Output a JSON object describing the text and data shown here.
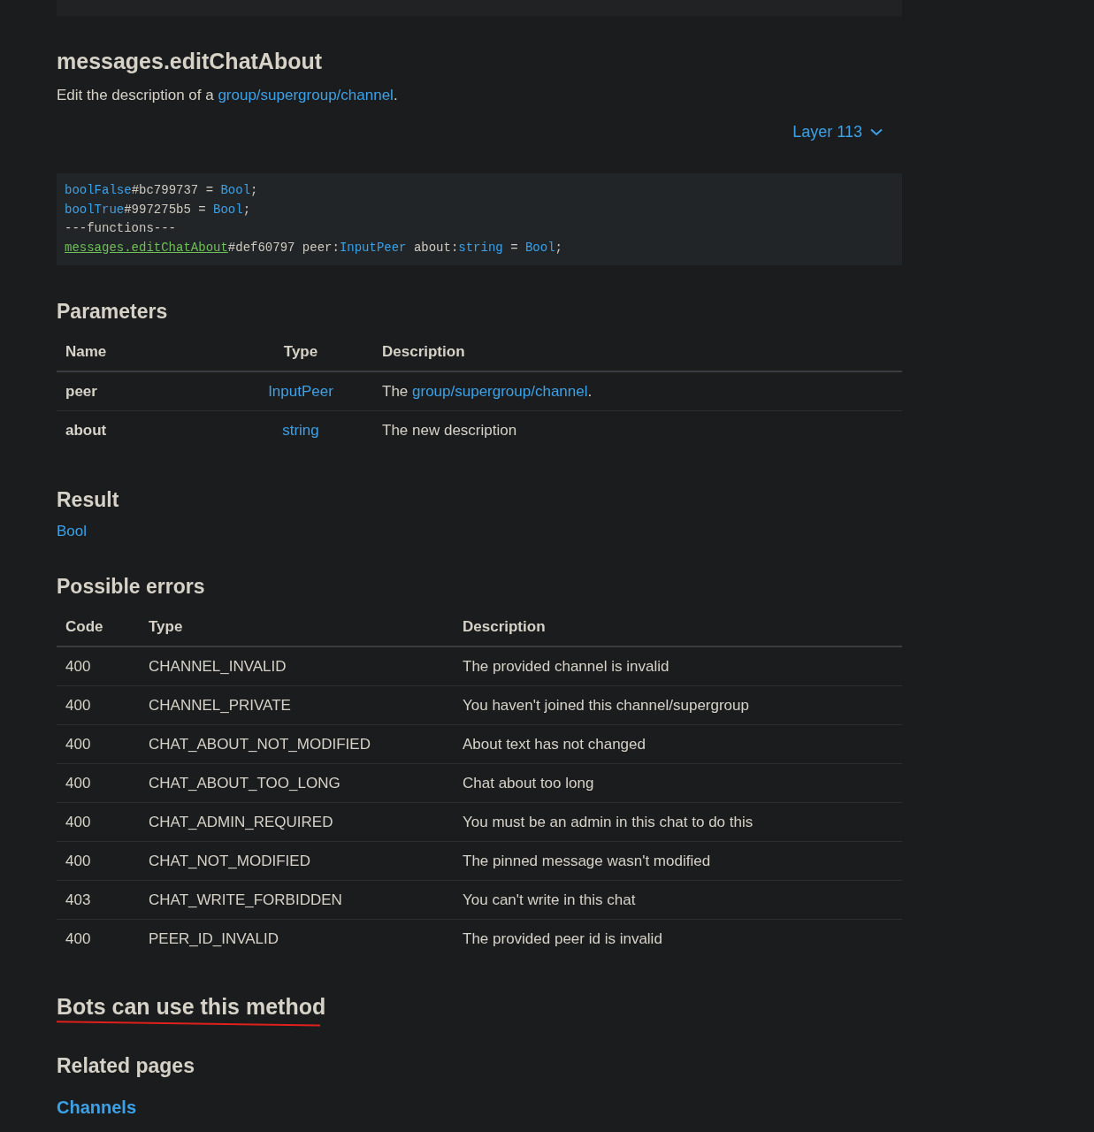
{
  "breadcrumb_bar": {
    "shown": true
  },
  "title": "messages.editChatAbout",
  "description": {
    "text": "Edit the description of a ",
    "link": "group/supergroup/channel",
    "after": "."
  },
  "layer_selector": {
    "label": "Layer 113"
  },
  "code": [
    [
      {
        "text": "boolFalse",
        "kind": "type"
      },
      {
        "text": "#bc799737 = ",
        "kind": "plain"
      },
      {
        "text": "Bool",
        "kind": "type"
      },
      {
        "text": ";",
        "kind": "plain"
      }
    ],
    [
      {
        "text": "boolTrue",
        "kind": "type"
      },
      {
        "text": "#997275b5 = ",
        "kind": "plain"
      },
      {
        "text": "Bool",
        "kind": "type"
      },
      {
        "text": ";",
        "kind": "plain"
      }
    ],
    [
      {
        "text": "---functions---",
        "kind": "plain"
      }
    ],
    [
      {
        "text": "messages.editChatAbout",
        "kind": "method"
      },
      {
        "text": "#def60797 peer:",
        "kind": "plain"
      },
      {
        "text": "InputPeer",
        "kind": "type"
      },
      {
        "text": " about:",
        "kind": "plain"
      },
      {
        "text": "string",
        "kind": "type"
      },
      {
        "text": " = ",
        "kind": "plain"
      },
      {
        "text": "Bool",
        "kind": "type"
      },
      {
        "text": ";",
        "kind": "plain"
      }
    ]
  ],
  "parameters": {
    "heading": "Parameters",
    "columns": [
      "Name",
      "Type",
      "Description"
    ],
    "rows": [
      {
        "name": "peer",
        "type": "InputPeer",
        "description": {
          "text": "The ",
          "link": "group/supergroup/channel",
          "after": "."
        }
      },
      {
        "name": "about",
        "type": "string",
        "description": {
          "text": "The new description"
        }
      }
    ]
  },
  "result": {
    "heading": "Result",
    "type": "Bool"
  },
  "errors": {
    "heading": "Possible errors",
    "columns": [
      "Code",
      "Type",
      "Description"
    ],
    "rows": [
      {
        "code": "400",
        "type": "CHANNEL_INVALID",
        "description": "The provided channel is invalid"
      },
      {
        "code": "400",
        "type": "CHANNEL_PRIVATE",
        "description": "You haven't joined this channel/supergroup"
      },
      {
        "code": "400",
        "type": "CHAT_ABOUT_NOT_MODIFIED",
        "description": "About text has not changed"
      },
      {
        "code": "400",
        "type": "CHAT_ABOUT_TOO_LONG",
        "description": "Chat about too long"
      },
      {
        "code": "400",
        "type": "CHAT_ADMIN_REQUIRED",
        "description": "You must be an admin in this chat to do this"
      },
      {
        "code": "400",
        "type": "CHAT_NOT_MODIFIED",
        "description": "The pinned message wasn't modified"
      },
      {
        "code": "403",
        "type": "CHAT_WRITE_FORBIDDEN",
        "description": "You can't write in this chat"
      },
      {
        "code": "400",
        "type": "PEER_ID_INVALID",
        "description": "The provided peer id is invalid"
      }
    ]
  },
  "bots": {
    "heading": "Bots can use this method",
    "underlined": true
  },
  "related": {
    "heading": "Related pages",
    "links": [
      "Channels"
    ]
  }
}
